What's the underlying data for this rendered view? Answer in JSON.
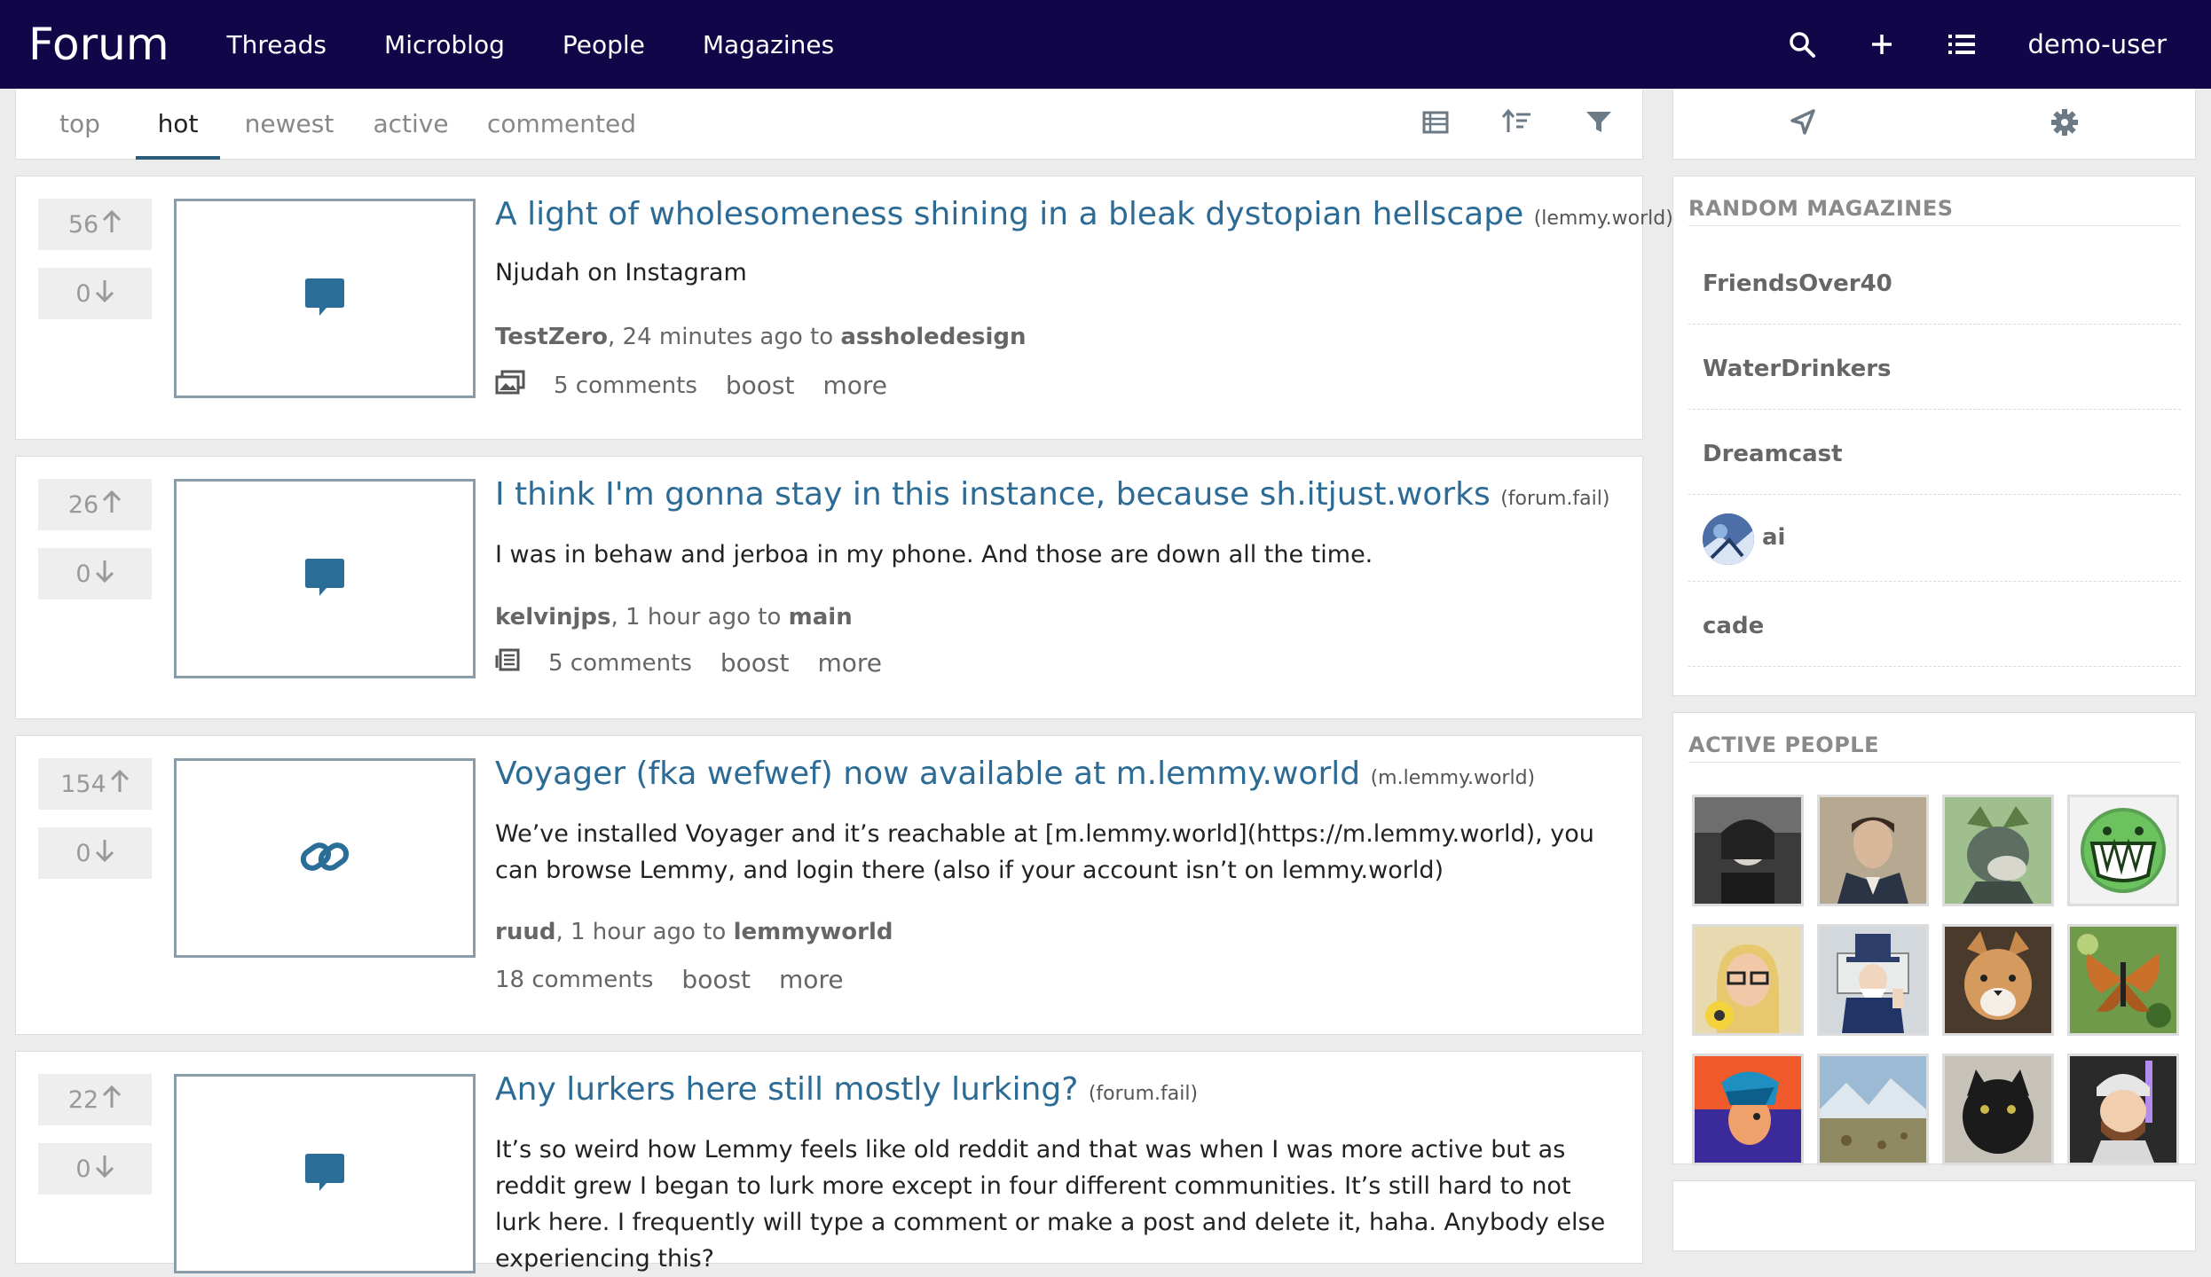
{
  "header": {
    "brand": "Forum",
    "nav": [
      "Threads",
      "Microblog",
      "People",
      "Magazines"
    ],
    "user": "demo-user",
    "icons": [
      "search-icon",
      "plus-icon",
      "list-icon"
    ]
  },
  "tabs": [
    "top",
    "hot",
    "newest",
    "active",
    "commented"
  ],
  "active_tab": "hot",
  "toolbar_icons": [
    "view-table-icon",
    "sort-icon",
    "filter-icon"
  ],
  "posts": [
    {
      "up": "56",
      "down": "0",
      "thumb_icon": "comment-icon",
      "title": "A light of wholesomeness shining in a bleak dystopian hellscape",
      "domain": "(lemmy.world)",
      "body": "Njudah on Instagram",
      "author": "TestZero",
      "time": ", 24 minutes ago to ",
      "magazine": "assholedesign",
      "comments": "5 comments",
      "boost": "boost",
      "more": "more"
    },
    {
      "up": "26",
      "down": "0",
      "thumb_icon": "comment-icon",
      "title": "I think I'm gonna stay in this instance, because sh.itjust.works",
      "domain": "(forum.fail)",
      "body": "I was in behaw and jerboa in my phone. And those are down all the time.",
      "author": "kelvinjps",
      "time": ", 1 hour ago to ",
      "magazine": "main",
      "comments": "5 comments",
      "boost": "boost",
      "more": "more"
    },
    {
      "up": "154",
      "down": "0",
      "thumb_icon": "link-icon",
      "title": "Voyager (fka wefwef) now available at m.lemmy.world",
      "domain": "(m.lemmy.world)",
      "body": "We’ve installed Voyager and it’s reachable at [m.lemmy.world](https://m.lemmy.world), you can browse Lemmy, and login there (also if your account isn’t on lemmy.world)",
      "author": "ruud",
      "time": ", 1 hour ago to ",
      "magazine": "lemmyworld",
      "comments": "18 comments",
      "boost": "boost",
      "more": "more"
    },
    {
      "up": "22",
      "down": "0",
      "thumb_icon": "comment-icon",
      "title": "Any lurkers here still mostly lurking?",
      "domain": "(forum.fail)",
      "body": "It’s so weird how Lemmy feels like old reddit and that was when I was more active but as reddit grew I began to lurk more except in four different communities. It’s still hard to not lurk here. I frequently will type a comment or make a post and delete it, haha. Anybody else experiencing this?"
    }
  ],
  "sidebar": {
    "random_title": "RANDOM MAGAZINES",
    "magazines": [
      "FriendsOver40",
      "WaterDrinkers",
      "Dreamcast",
      "ai",
      "cade"
    ],
    "people_title": "ACTIVE PEOPLE"
  },
  "colors": {
    "nav_bg": "#110648",
    "link": "#2c6b95",
    "icon": "#2a6d97"
  }
}
